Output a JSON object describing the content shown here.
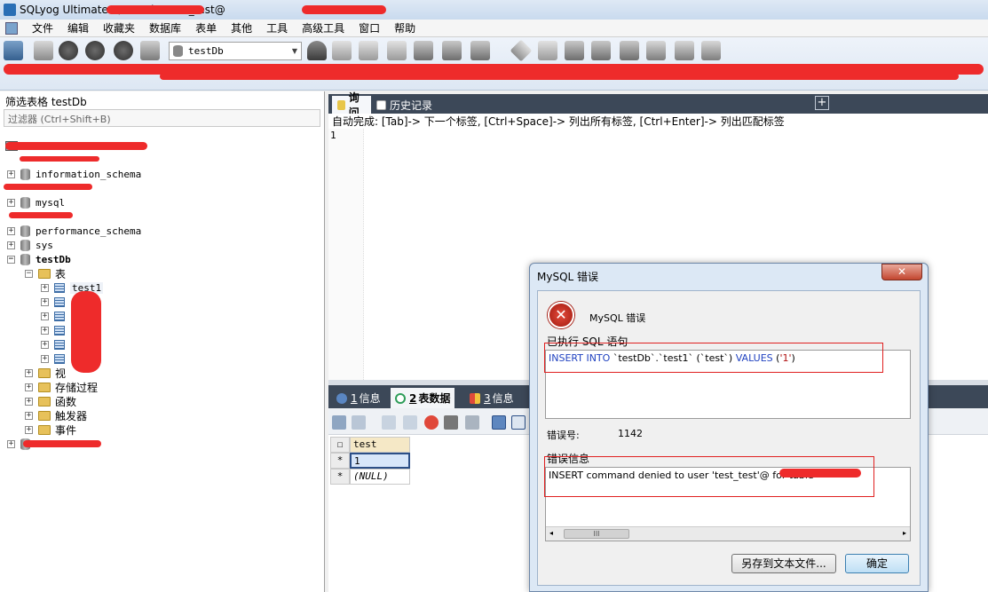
{
  "window": {
    "title": "SQLyog Ultimate - /testDb - test_test@"
  },
  "menu": [
    "文件",
    "编辑",
    "收藏夹",
    "数据库",
    "表单",
    "其他",
    "工具",
    "高级工具",
    "窗口",
    "帮助"
  ],
  "toolbar": {
    "database_select": "testDb"
  },
  "left_panel": {
    "header": "筛选表格 testDb",
    "filter_placeholder": "过滤器 (Ctrl+Shift+B)",
    "tree": {
      "db_information_schema": "information_schema",
      "db_mysql": "mysql",
      "db_performance_schema": "performance_schema",
      "db_sys": "sys",
      "db_testdb": "testDb",
      "folder_tables": "表",
      "table_test1": "test1",
      "folder_views": "视",
      "folder_procedures": "存储过程",
      "folder_functions": "函数",
      "folder_triggers": "触发器",
      "folder_events": "事件"
    }
  },
  "editor": {
    "tab_query": "询问",
    "tab_history": "历史记录",
    "add_tab": "+",
    "autocomplete_hint": "自动完成: [Tab]-> 下一个标签, [Ctrl+Space]-> 列出所有标签, [Ctrl+Enter]-> 列出匹配标签",
    "line_number": "1"
  },
  "results": {
    "tab1": {
      "num": "1",
      "label": "信息"
    },
    "tab2": {
      "num": "2",
      "label": "表数据"
    },
    "tab3": {
      "num": "3",
      "label": "信息"
    },
    "grid": {
      "column_header": "test",
      "rows": [
        {
          "marker": "*",
          "value": "1"
        },
        {
          "marker": "*",
          "value": "(NULL)"
        }
      ]
    }
  },
  "dialog": {
    "title": "MySQL 错误",
    "close": "✕",
    "heading": "MySQL 错误",
    "sql_label": "已执行 SQL 语句",
    "sql": {
      "kw1": "INSERT INTO",
      "part1": " `testDb`.`test1` (`test`) ",
      "kw2": "VALUES",
      "part2": " (",
      "val": "'1'",
      "part3": ")"
    },
    "errno_label": "错误号:",
    "errno": "1142",
    "errmsg_label": "错误信息",
    "errmsg": "INSERT command denied to user 'test_test'@                  for table '",
    "scroll_thumb": "III",
    "save_button": "另存到文本文件...",
    "ok_button": "确定"
  }
}
